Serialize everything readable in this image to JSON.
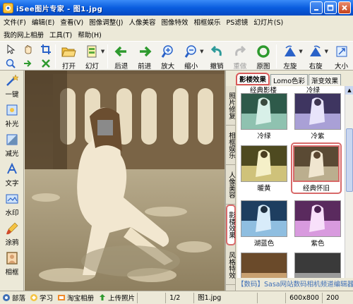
{
  "window": {
    "title": "iSee图片专家 - 图1.jpg"
  },
  "menu": {
    "row1": [
      "文件(F)",
      "编辑(E)",
      "查看(V)",
      "图像调整(J)",
      "人像美容",
      "图像特效",
      "相框娱乐",
      "PS滤镜",
      "幻灯片(S)"
    ],
    "row2": [
      "我的网上相册",
      "工具(T)",
      "帮助(H)"
    ]
  },
  "toolbar": {
    "open": "打开",
    "slideshow": "幻灯",
    "back": "后退",
    "forward": "前进",
    "zoom_in": "放大",
    "zoom_out": "缩小",
    "undo": "撤销",
    "redo": "重做",
    "original": "原图",
    "rotate_left": "左旋",
    "rotate_right": "右旋",
    "size": "大小"
  },
  "left_tools": [
    "一键",
    "补光",
    "减光",
    "文字",
    "水印",
    "涂鸦",
    "相框"
  ],
  "right_panel": {
    "tabs": [
      "影楼效果",
      "Lomo色彩",
      "渐变效果"
    ],
    "side_tabs": [
      "照片修复",
      "相框娱乐",
      "人像美容",
      "影楼效果",
      "风格特效"
    ],
    "top_partial_labels": [
      "经典影楼",
      "冷绿"
    ],
    "thumbnails": [
      {
        "label": "冷绿",
        "tone": "#7FB9A8"
      },
      {
        "label": "冷紫",
        "tone": "#9E8FD0"
      },
      {
        "label": "暖黄",
        "tone": "#C8B86A"
      },
      {
        "label": "经典怀旧",
        "tone": "#B8A88A",
        "selected": true
      },
      {
        "label": "湖蓝色",
        "tone": "#6FA7D0"
      },
      {
        "label": "紫色",
        "tone": "#C07AC8"
      }
    ],
    "watermark": "【数码】Sasa网站数码相机频道编辑器"
  },
  "status": {
    "items": [
      "部落",
      "学习",
      "淘宝相册",
      "上传照片"
    ],
    "page": "1/2",
    "filename": "图1.jpg",
    "size": "600x800",
    "zoom": "200"
  }
}
